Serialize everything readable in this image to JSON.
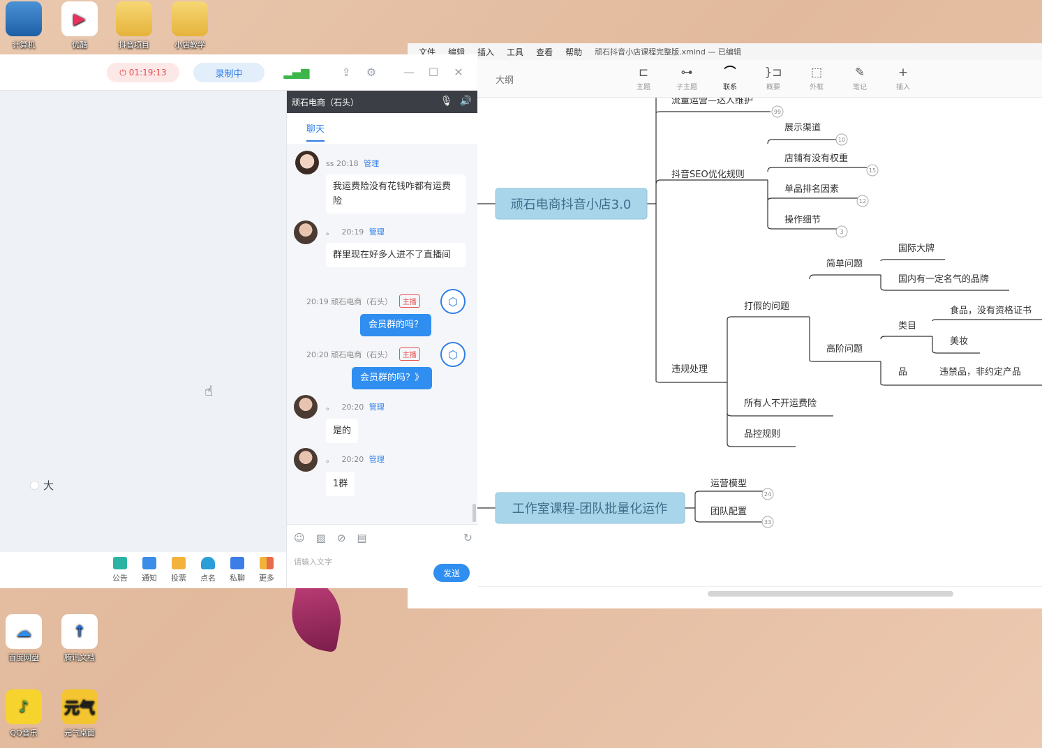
{
  "desktop": {
    "icons_top": [
      {
        "label": "计算机",
        "glyph": "▣"
      },
      {
        "label": "优酷",
        "glyph": "▶"
      },
      {
        "label": "抖音项目",
        "glyph": ""
      },
      {
        "label": "小店教学",
        "glyph": ""
      }
    ],
    "icons_bottom": [
      {
        "label": "百度网盘",
        "glyph": "☁"
      },
      {
        "label": "腾讯文档",
        "glyph": "↑"
      },
      {
        "label": "QQ音乐",
        "glyph": "♪"
      },
      {
        "label": "元气桌面",
        "glyph": "元气"
      }
    ]
  },
  "live": {
    "timer": "01:19:13",
    "recording_label": "录制中",
    "radio_label": "大",
    "tools": [
      "公告",
      "通知",
      "投票",
      "点名",
      "私聊",
      "更多"
    ]
  },
  "chat": {
    "channel_title": "顽石电商（石头）",
    "tab": "聊天",
    "messages": [
      {
        "sender": "ss",
        "time": "20:18",
        "role": "管理",
        "text": "我运费险没有花钱咋都有运费险"
      },
      {
        "sender": "。",
        "time": "20:19",
        "role": "管理",
        "text": "群里现在好多人进不了直播间"
      },
      {
        "time": "20:19",
        "sender": "顽石电商（石头）",
        "tag": "主播",
        "text": "会员群的吗？"
      },
      {
        "time": "20:20",
        "sender": "顽石电商（石头）",
        "tag": "主播",
        "text": "会员群的吗？》"
      },
      {
        "sender": "。",
        "time": "20:20",
        "role": "管理",
        "text": "是的"
      },
      {
        "sender": "。",
        "time": "20:20",
        "role": "管理",
        "text": "1群"
      }
    ],
    "input_placeholder": "请输入文字",
    "send_label": "发送"
  },
  "xmind": {
    "menu": [
      "文件",
      "编辑",
      "插入",
      "工具",
      "查看",
      "帮助"
    ],
    "doc_title": "顽石抖音小店课程完整版.xmind — 已编辑",
    "outline_label": "大纲",
    "toolbar": [
      {
        "icon": "⊏",
        "label": "主题"
      },
      {
        "icon": "⊶",
        "label": "子主题"
      },
      {
        "icon": "⌒",
        "label": "联系"
      },
      {
        "icon": "}⊐",
        "label": "概要"
      },
      {
        "icon": "⬚",
        "label": "外框"
      },
      {
        "icon": "✎",
        "label": "笔记"
      },
      {
        "icon": "+",
        "label": "插入"
      }
    ],
    "map": {
      "top_partial": "流量运营—达人维护",
      "central_1": "顽石电商抖音小店3.0",
      "central_2": "工作室课程-团队批量化运作",
      "seo": "抖音SEO优化规则",
      "seo_children": [
        "展示渠道",
        "店铺有没有权重",
        "单品排名因素",
        "操作细节"
      ],
      "violation": "违规处理",
      "fake": "打假的问题",
      "simple": "简单问题",
      "simple_children": [
        "国际大牌",
        "国内有一定名气的品牌"
      ],
      "advanced": "高阶问题",
      "category": "类目",
      "category_children": [
        "食品，没有资格证书",
        "美妆"
      ],
      "product": "品",
      "product_child": "违禁品，非约定产品",
      "nofee": "所有人不开运费险",
      "quality": "品控规则",
      "studio_children": [
        "运营模型",
        "团队配置"
      ],
      "badges": [
        "99",
        "10",
        "15",
        "12",
        "3",
        "24",
        "33"
      ]
    }
  }
}
